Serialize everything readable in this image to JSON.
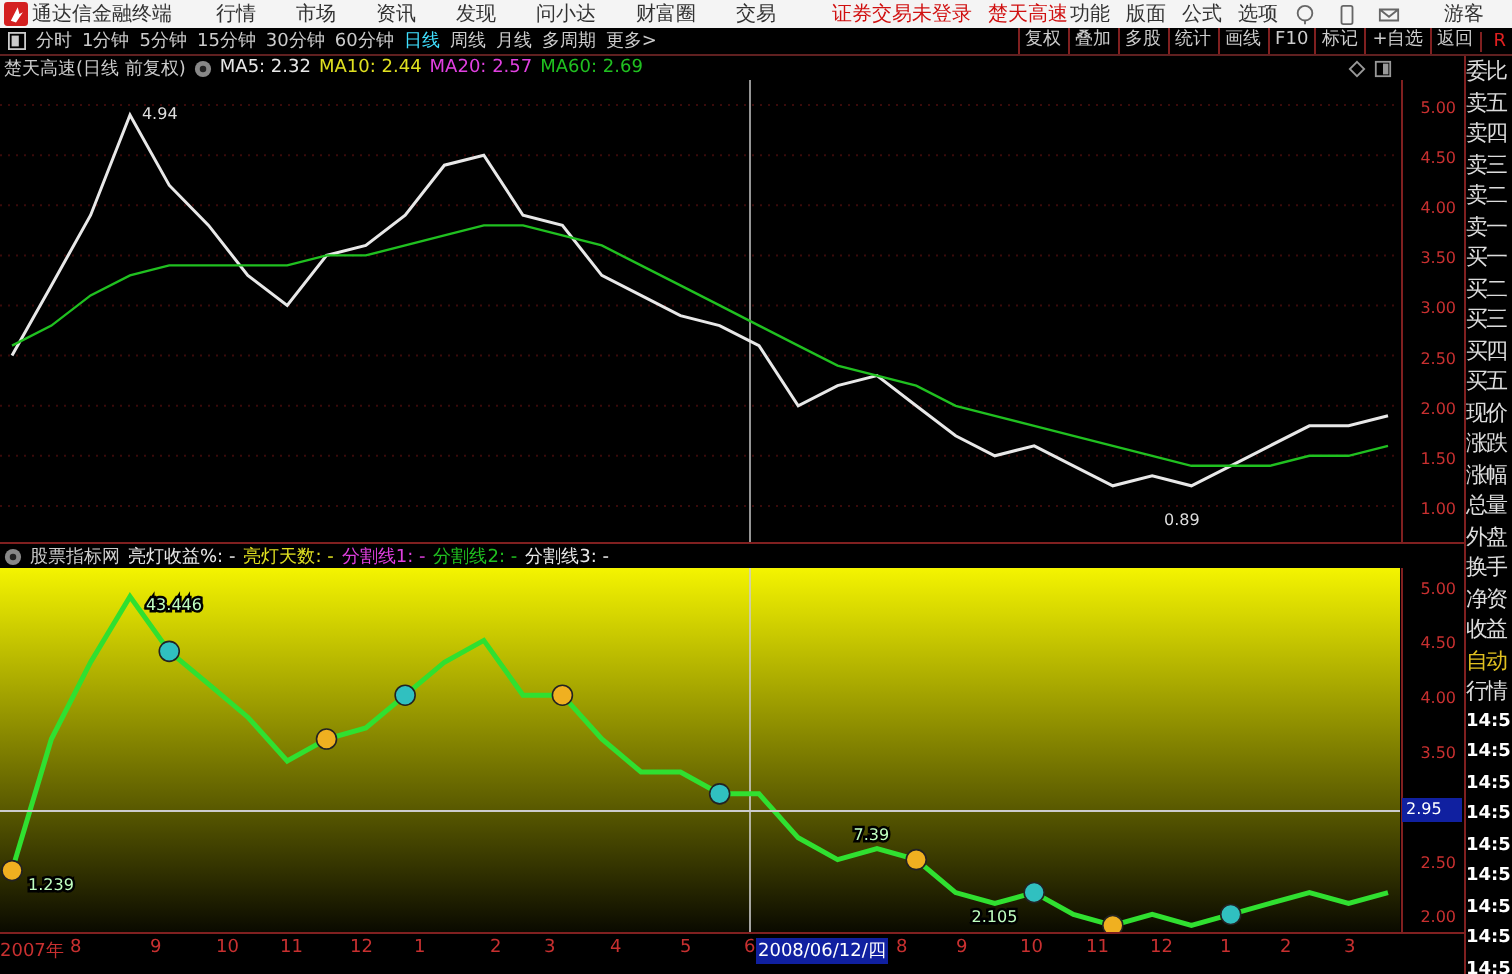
{
  "menu_bar": {
    "app_title": "通达信金融终端",
    "items": [
      "行情",
      "市场",
      "资讯",
      "发现",
      "问小达",
      "财富圈",
      "交易"
    ],
    "login_status": "证券交易未登录",
    "stock_name": "楚天高速",
    "right_items": [
      "功能",
      "版面",
      "公式",
      "选项"
    ],
    "user": "游客"
  },
  "period_tabs": [
    {
      "label": "分时",
      "selected": false
    },
    {
      "label": "1分钟",
      "selected": false
    },
    {
      "label": "5分钟",
      "selected": false
    },
    {
      "label": "15分钟",
      "selected": false
    },
    {
      "label": "30分钟",
      "selected": false
    },
    {
      "label": "60分钟",
      "selected": false
    },
    {
      "label": "日线",
      "selected": true
    },
    {
      "label": "周线",
      "selected": false
    },
    {
      "label": "月线",
      "selected": false
    },
    {
      "label": "多周期",
      "selected": false
    },
    {
      "label": "更多>",
      "selected": false
    }
  ],
  "tool_buttons": [
    "复权",
    "叠加",
    "多股",
    "统计",
    "画线",
    "F10",
    "标记",
    "+自选",
    "返回"
  ],
  "tool_cut": "R",
  "main_chart": {
    "title": "楚天高速(日线 前复权)",
    "indicators": [
      {
        "label": "MA5: 2.32",
        "color": "#e8e8e8"
      },
      {
        "label": "MA10: 2.44",
        "color": "#e0e020"
      },
      {
        "label": "MA20: 2.57",
        "color": "#e040e0"
      },
      {
        "label": "MA60: 2.69",
        "color": "#20c020"
      }
    ],
    "chart_data": {
      "type": "line",
      "grid": true,
      "ylim": [
        0.64,
        5.25
      ],
      "yticks": [
        {
          "value": 1,
          "label": "1.00"
        },
        {
          "value": 1.5,
          "label": "1.50"
        },
        {
          "value": 2,
          "label": "2.00"
        },
        {
          "value": 2.5,
          "label": "2.50"
        },
        {
          "value": 3,
          "label": "3.00"
        },
        {
          "value": 3.5,
          "label": "3.50"
        },
        {
          "value": 4,
          "label": "4.00"
        },
        {
          "value": 4.5,
          "label": "4.50"
        },
        {
          "value": 5,
          "label": "5.00"
        }
      ],
      "series": [
        {
          "color": "#e8e8e8",
          "values": [
            2.5,
            3.2,
            3.9,
            4.9,
            4.2,
            3.8,
            3.3,
            3.0,
            3.5,
            3.6,
            3.9,
            4.4,
            4.5,
            3.9,
            3.8,
            3.3,
            3.1,
            2.9,
            2.8,
            2.6,
            2.0,
            2.2,
            2.3,
            2.0,
            1.7,
            1.5,
            1.6,
            1.4,
            1.2,
            1.3,
            1.2,
            1.4,
            1.6,
            1.8,
            1.8,
            1.9
          ]
        },
        {
          "color": "#20c020",
          "values": [
            2.6,
            2.8,
            3.1,
            3.3,
            3.4,
            3.4,
            3.4,
            3.4,
            3.5,
            3.5,
            3.6,
            3.7,
            3.8,
            3.8,
            3.7,
            3.6,
            3.4,
            3.2,
            3.0,
            2.8,
            2.6,
            2.4,
            2.3,
            2.2,
            2.0,
            1.9,
            1.8,
            1.7,
            1.6,
            1.5,
            1.4,
            1.4,
            1.4,
            1.5,
            1.5,
            1.6
          ]
        }
      ],
      "annotations": [
        "4.94",
        "0.89"
      ]
    }
  },
  "indicator_panel": {
    "source": "股票指标网",
    "items": [
      {
        "label": "亮灯收益%: -",
        "color": "#e8e8e8"
      },
      {
        "label": "亮灯天数: -",
        "color": "#e0e020"
      },
      {
        "label": "分割线1: -",
        "color": "#e040e0"
      },
      {
        "label": "分割线2: -",
        "color": "#20c020"
      },
      {
        "label": "分割线3: -",
        "color": "#e8e8e8"
      }
    ],
    "crosshair_value": "2.95",
    "chart_data": {
      "type": "line",
      "ylim": [
        1.84,
        5.16
      ],
      "yticks": [
        {
          "value": 2,
          "label": "2.00"
        },
        {
          "value": 2.5,
          "label": "2.50"
        },
        {
          "value": 3.5,
          "label": "3.50"
        },
        {
          "value": 4,
          "label": "4.00"
        },
        {
          "value": 4.5,
          "label": "4.50"
        },
        {
          "value": 5,
          "label": "5.00"
        }
      ],
      "series": [
        {
          "color": "#30e030",
          "values": [
            2.4,
            3.6,
            4.3,
            4.9,
            4.4,
            4.1,
            3.8,
            3.4,
            3.6,
            3.7,
            4.0,
            4.3,
            4.5,
            4.0,
            4.0,
            3.6,
            3.3,
            3.3,
            3.1,
            3.1,
            2.7,
            2.5,
            2.6,
            2.5,
            2.2,
            2.1,
            2.2,
            2.0,
            1.9,
            2.0,
            1.9,
            2.0,
            2.1,
            2.2,
            2.1,
            2.2
          ]
        }
      ],
      "annotations": [
        "43.446",
        "1.239",
        "7.39",
        "2.105"
      ]
    }
  },
  "x_axis": [
    "2007年",
    "8",
    "9",
    "10",
    "11",
    "12",
    "1",
    "2",
    "3",
    "4",
    "5",
    "6",
    "2008/06/12/四",
    "8",
    "9",
    "10",
    "11",
    "12",
    "1",
    "2",
    "3"
  ],
  "side_panel": {
    "labels": [
      "委比",
      "卖五",
      "卖四",
      "卖三",
      "卖二",
      "卖一",
      "买一",
      "买二",
      "买三",
      "买四",
      "买五",
      "现价",
      "涨跌",
      "涨幅",
      "总量",
      "外盘",
      "换手",
      "净资",
      "收益"
    ],
    "mode": "自动",
    "mode2": "行情",
    "times": [
      "14:5",
      "14:5",
      "14:5",
      "14:5",
      "14:5",
      "14:5",
      "14:5",
      "14:5",
      "14:5"
    ]
  }
}
